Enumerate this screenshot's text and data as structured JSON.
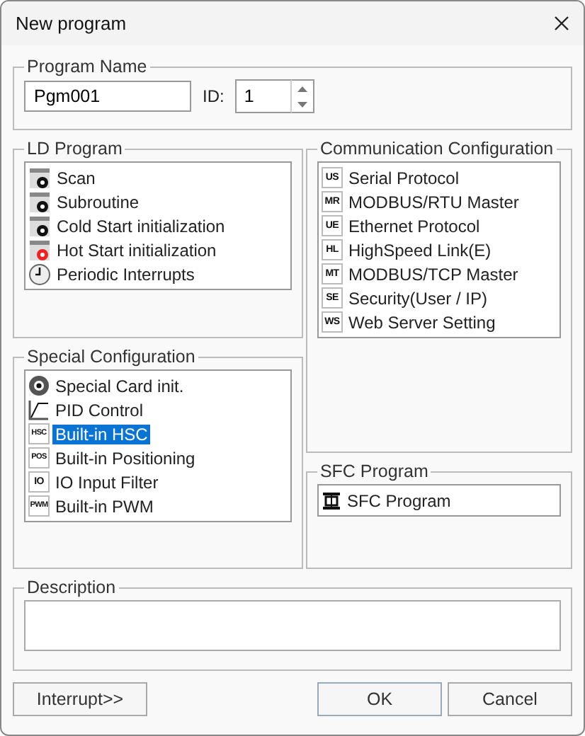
{
  "window": {
    "title": "New program"
  },
  "program_name": {
    "legend": "Program Name",
    "value": "Pgm001",
    "id_label": "ID:",
    "id_value": "1"
  },
  "ld_program": {
    "legend": "LD Program",
    "items": [
      {
        "label": "Scan",
        "kind": "scan",
        "selected": false
      },
      {
        "label": "Subroutine",
        "kind": "subroutine",
        "selected": false
      },
      {
        "label": "Cold Start initialization",
        "kind": "cold",
        "selected": false
      },
      {
        "label": "Hot Start initialization",
        "kind": "hot",
        "selected": false
      },
      {
        "label": "Periodic Interrupts",
        "kind": "clock",
        "selected": false
      }
    ]
  },
  "communication": {
    "legend": "Communication Configuration",
    "items": [
      {
        "code": "US",
        "label": "Serial Protocol",
        "selected": false
      },
      {
        "code": "MR",
        "label": "MODBUS/RTU Master",
        "selected": false
      },
      {
        "code": "UE",
        "label": "Ethernet Protocol",
        "selected": false
      },
      {
        "code": "HL",
        "label": "HighSpeed Link(E)",
        "selected": false
      },
      {
        "code": "MT",
        "label": "MODBUS/TCP Master",
        "selected": false
      },
      {
        "code": "SE",
        "label": "Security(User / IP)",
        "selected": false
      },
      {
        "code": "WS",
        "label": "Web Server Setting",
        "selected": false
      }
    ]
  },
  "special": {
    "legend": "Special Configuration",
    "items": [
      {
        "kind": "card",
        "label": "Special Card init.",
        "selected": false
      },
      {
        "kind": "pid",
        "label": "PID Control",
        "selected": false
      },
      {
        "kind": "code",
        "code": "HSC",
        "label": "Built-in HSC",
        "selected": true
      },
      {
        "kind": "code",
        "code": "POS",
        "label": "Built-in Positioning",
        "selected": false
      },
      {
        "kind": "code",
        "code": "IO",
        "label": "IO Input Filter",
        "selected": false
      },
      {
        "kind": "code",
        "code": "PWM",
        "label": "Built-in PWM",
        "selected": false
      }
    ]
  },
  "sfc": {
    "legend": "SFC Program",
    "items": [
      {
        "label": "SFC Program",
        "selected": false
      }
    ]
  },
  "description": {
    "legend": "Description"
  },
  "buttons": {
    "interrupt": "Interrupt>>",
    "ok": "OK",
    "cancel": "Cancel"
  }
}
